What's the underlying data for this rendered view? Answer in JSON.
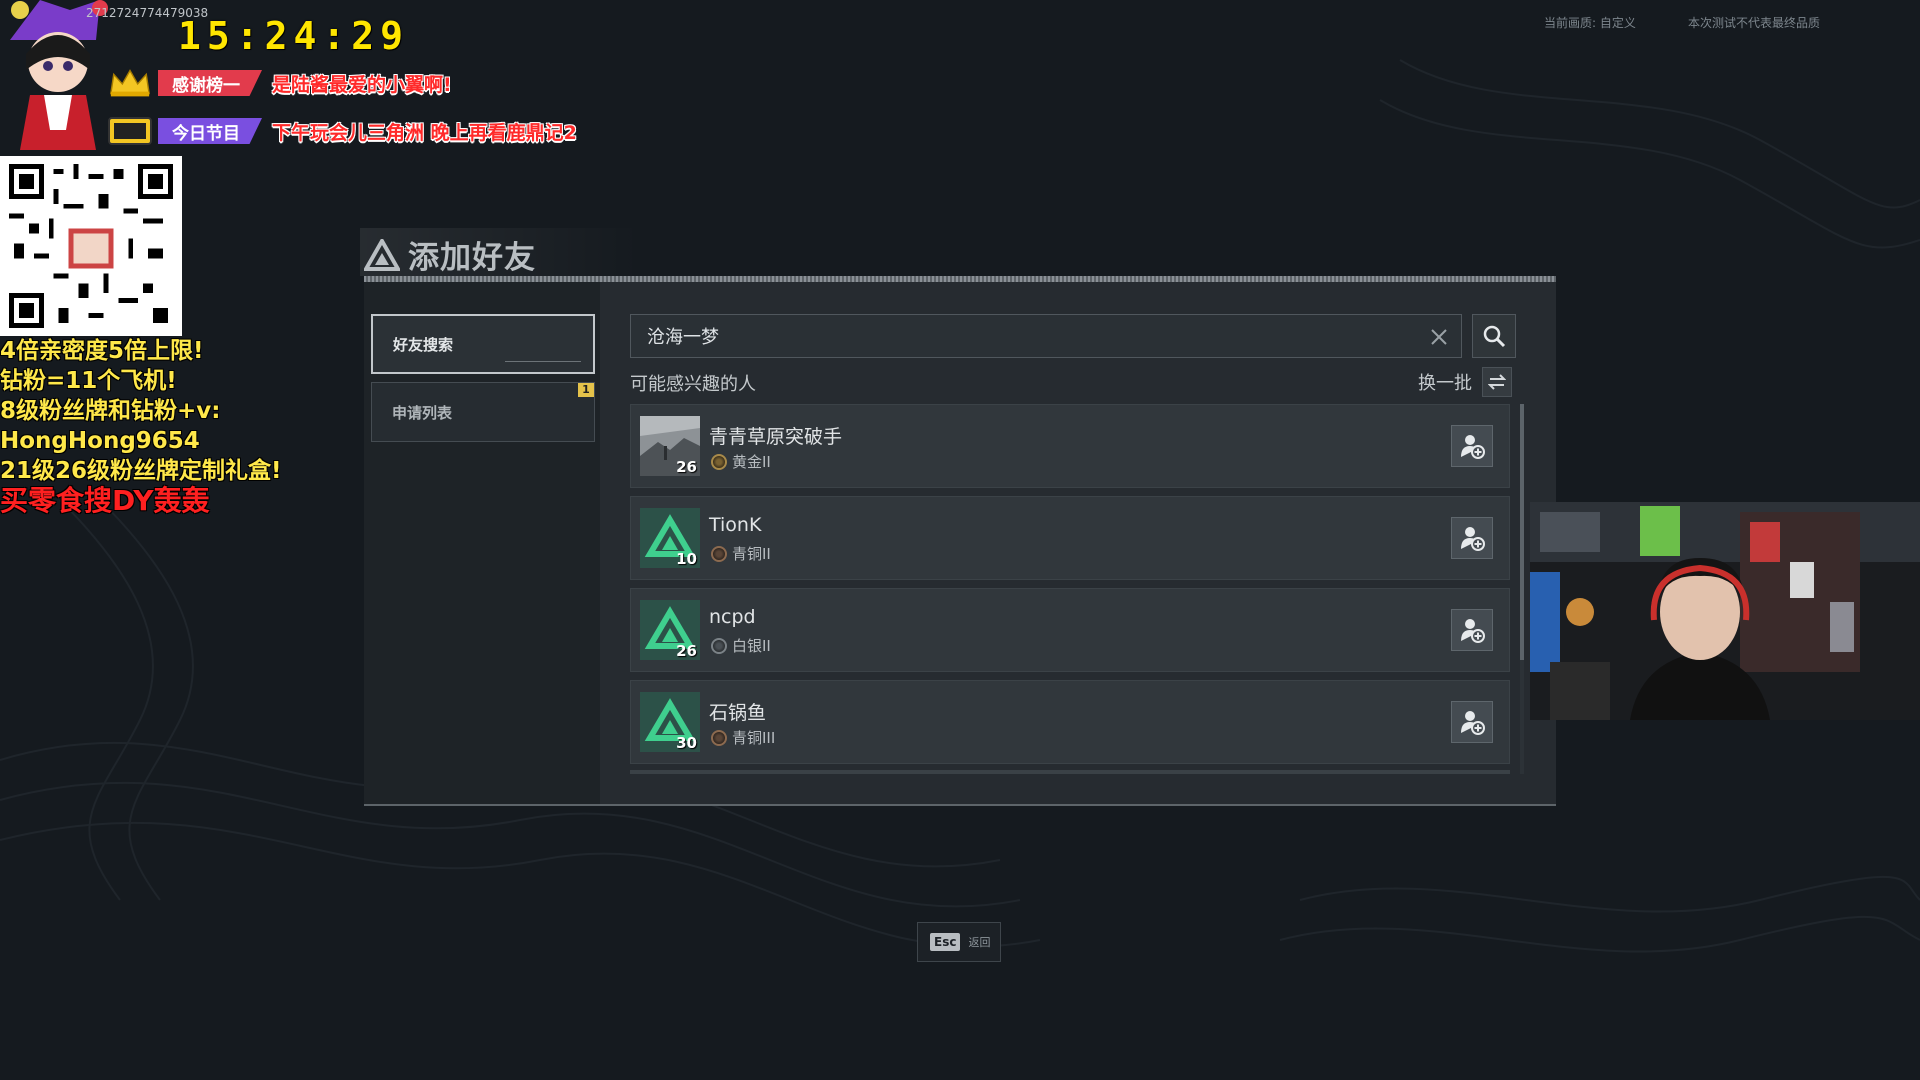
{
  "stream_overlay": {
    "stream_id": "2712724774479038",
    "clock": "15:24:29",
    "rows": [
      {
        "tag": "感谢榜一",
        "message": "是陆酱最爱的小翼啊!",
        "icon": "crown-icon"
      },
      {
        "tag": "今日节目",
        "message": "下午玩会儿三角洲 晚上再看鹿鼎记2",
        "icon": "tv-icon"
      }
    ],
    "promo_lines": [
      "4倍亲密度5倍上限!",
      "钻粉=11个飞机!",
      "8级粉丝牌和钻粉+v:",
      "HongHong9654",
      "21级26级粉丝牌定制礼盒!",
      "买零食搜DY轰轰"
    ]
  },
  "hud": {
    "quality_label": "当前画质: 自定义",
    "disclaimer": "本次测试不代表最终品质"
  },
  "dialog": {
    "title": "添加好友",
    "tabs": [
      {
        "label": "好友搜索",
        "active": true
      },
      {
        "label": "申请列表",
        "active": false,
        "badge": "1"
      }
    ],
    "search": {
      "value": "沧海一梦"
    },
    "suggest_label": "可能感兴趣的人",
    "refresh_label": "换一批",
    "players": [
      {
        "name": "青青草原突破手",
        "level": "26",
        "rank": "黄金II",
        "rank_tier": "gold",
        "avatar": "photo"
      },
      {
        "name": "TionK",
        "level": "10",
        "rank": "青铜II",
        "rank_tier": "bronze",
        "avatar": "default"
      },
      {
        "name": "ncpd",
        "level": "26",
        "rank": "白银II",
        "rank_tier": "silver",
        "avatar": "default"
      },
      {
        "name": "石锅鱼",
        "level": "30",
        "rank": "青铜III",
        "rank_tier": "bronze",
        "avatar": "default"
      }
    ]
  },
  "footer": {
    "esc_key": "Esc",
    "esc_label": "返回"
  },
  "colors": {
    "background": "#151a1f",
    "panel": "#262b30",
    "row": "#31373c",
    "logo_green": "#3fcf8e",
    "clock_yellow": "#ffe600",
    "promo_yellow": "#ffe84a"
  }
}
